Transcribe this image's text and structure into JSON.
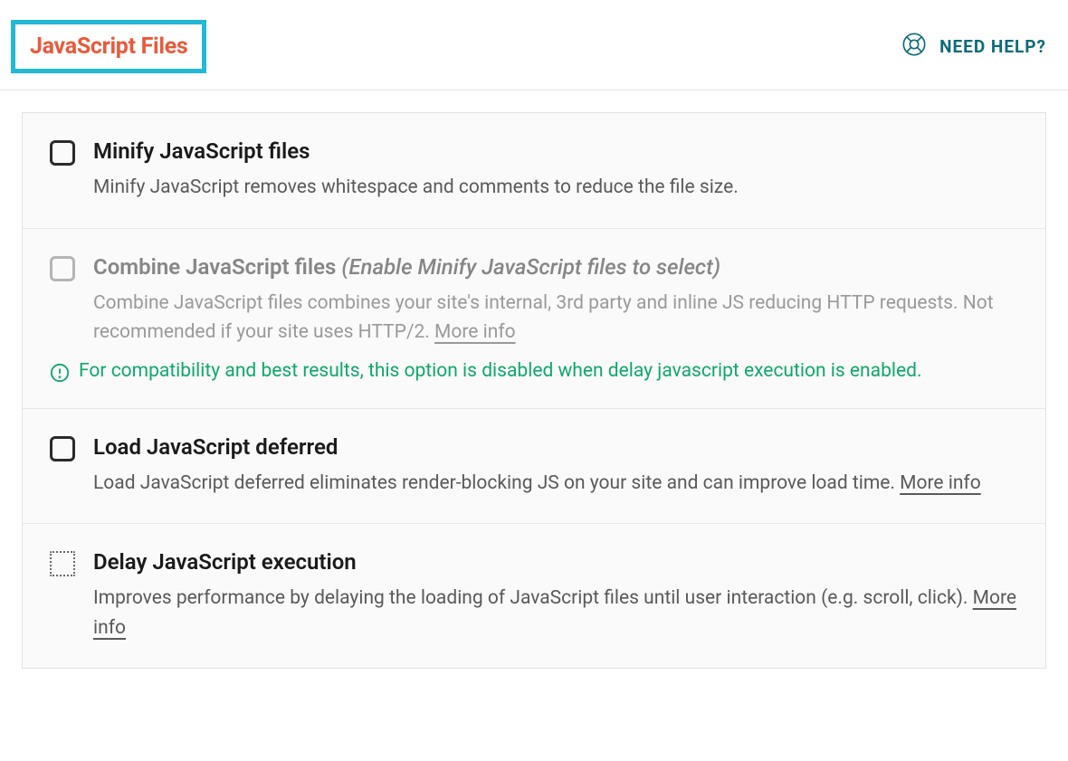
{
  "header": {
    "title": "JavaScript Files",
    "help_label": "NEED HELP?"
  },
  "options": [
    {
      "id": "minify",
      "title": "Minify JavaScript files",
      "desc": "Minify JavaScript removes whitespace and comments to reduce the file size.",
      "enabled": true
    },
    {
      "id": "combine",
      "title": "Combine JavaScript files",
      "hint": "(Enable Minify JavaScript files to select)",
      "desc": "Combine JavaScript files combines your site's internal, 3rd party and inline JS reducing HTTP requests. Not recommended if your site uses HTTP/2.",
      "more_info": "More info",
      "notice": "For compatibility and best results, this option is disabled when delay javascript execution is enabled.",
      "enabled": false
    },
    {
      "id": "defer",
      "title": "Load JavaScript deferred",
      "desc": "Load JavaScript deferred eliminates render-blocking JS on your site and can improve load time.",
      "more_info": "More info",
      "enabled": true
    },
    {
      "id": "delay",
      "title": "Delay JavaScript execution",
      "desc": "Improves performance by delaying the loading of JavaScript files until user interaction (e.g. scroll, click).",
      "more_info": "More info",
      "enabled": true,
      "dotted": true
    }
  ]
}
